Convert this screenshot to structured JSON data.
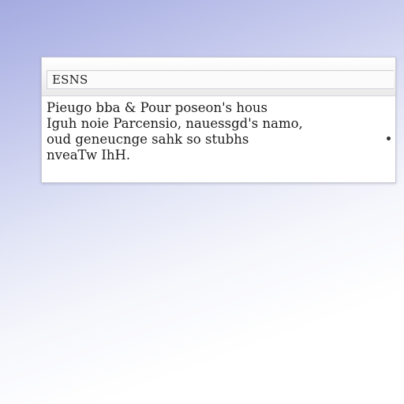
{
  "dialog": {
    "title": "ESNS",
    "message_lines": [
      "Pieugo  bba  &  Pour  poseon's  hous",
      "Iguh  noie  Parcensio,  nauessgd's  namo,",
      "oud  geneucnge  sahk  so  stubhs",
      "nveaTw  IhH."
    ]
  }
}
